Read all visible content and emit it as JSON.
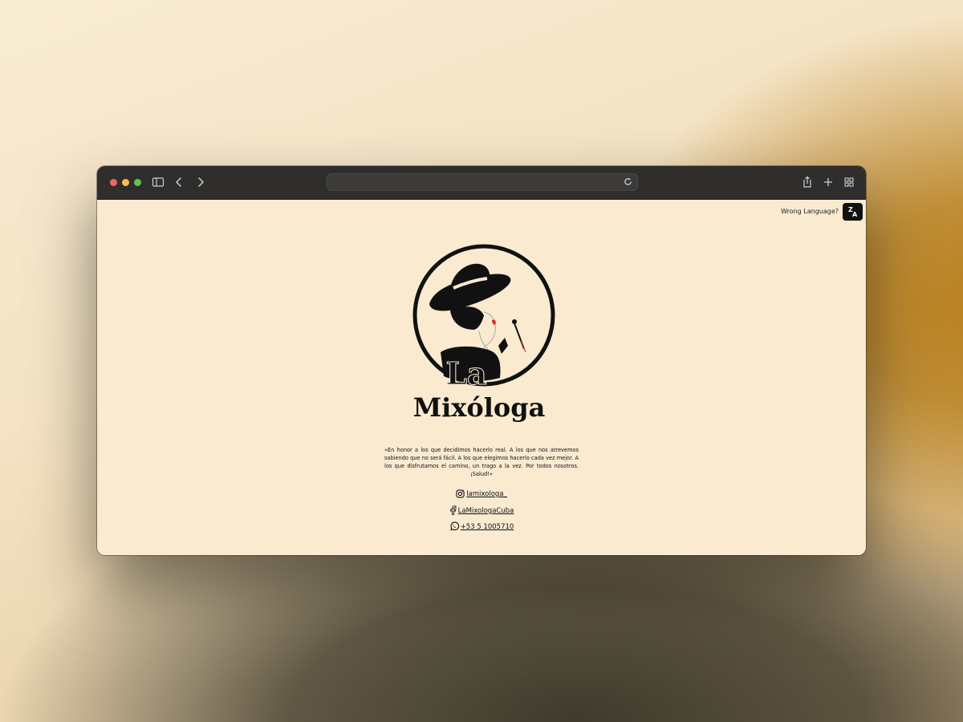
{
  "browser": {
    "url_value": "",
    "icons": [
      "sidebar-icon",
      "back-icon",
      "forward-icon",
      "reload-icon",
      "share-icon",
      "new-tab-icon",
      "tab-overview-icon"
    ]
  },
  "page": {
    "wrong_language_label": "Wrong Language?",
    "translate_icon": "translate-icon",
    "logo_text_line1": "La",
    "logo_text_line2": "Mixóloga",
    "quote": "«En honor a los que decidimos hacerlo real. A los que nos atrevemos sabiendo que no será fácil. A los que elegimos hacerlo cada vez mejor. A los que disfrutamos el camino, un trago a la vez. Por todos nosotros. ¡Salud!»",
    "social": {
      "instagram": "lamixologa_",
      "facebook": "LaMixologaCuba",
      "whatsapp": "+53 5 1005710"
    }
  },
  "colors": {
    "page_bg": "#f9ead0",
    "toolbar_bg": "#2f2e2c",
    "ink": "#111111",
    "lip_red": "#d2302a"
  }
}
